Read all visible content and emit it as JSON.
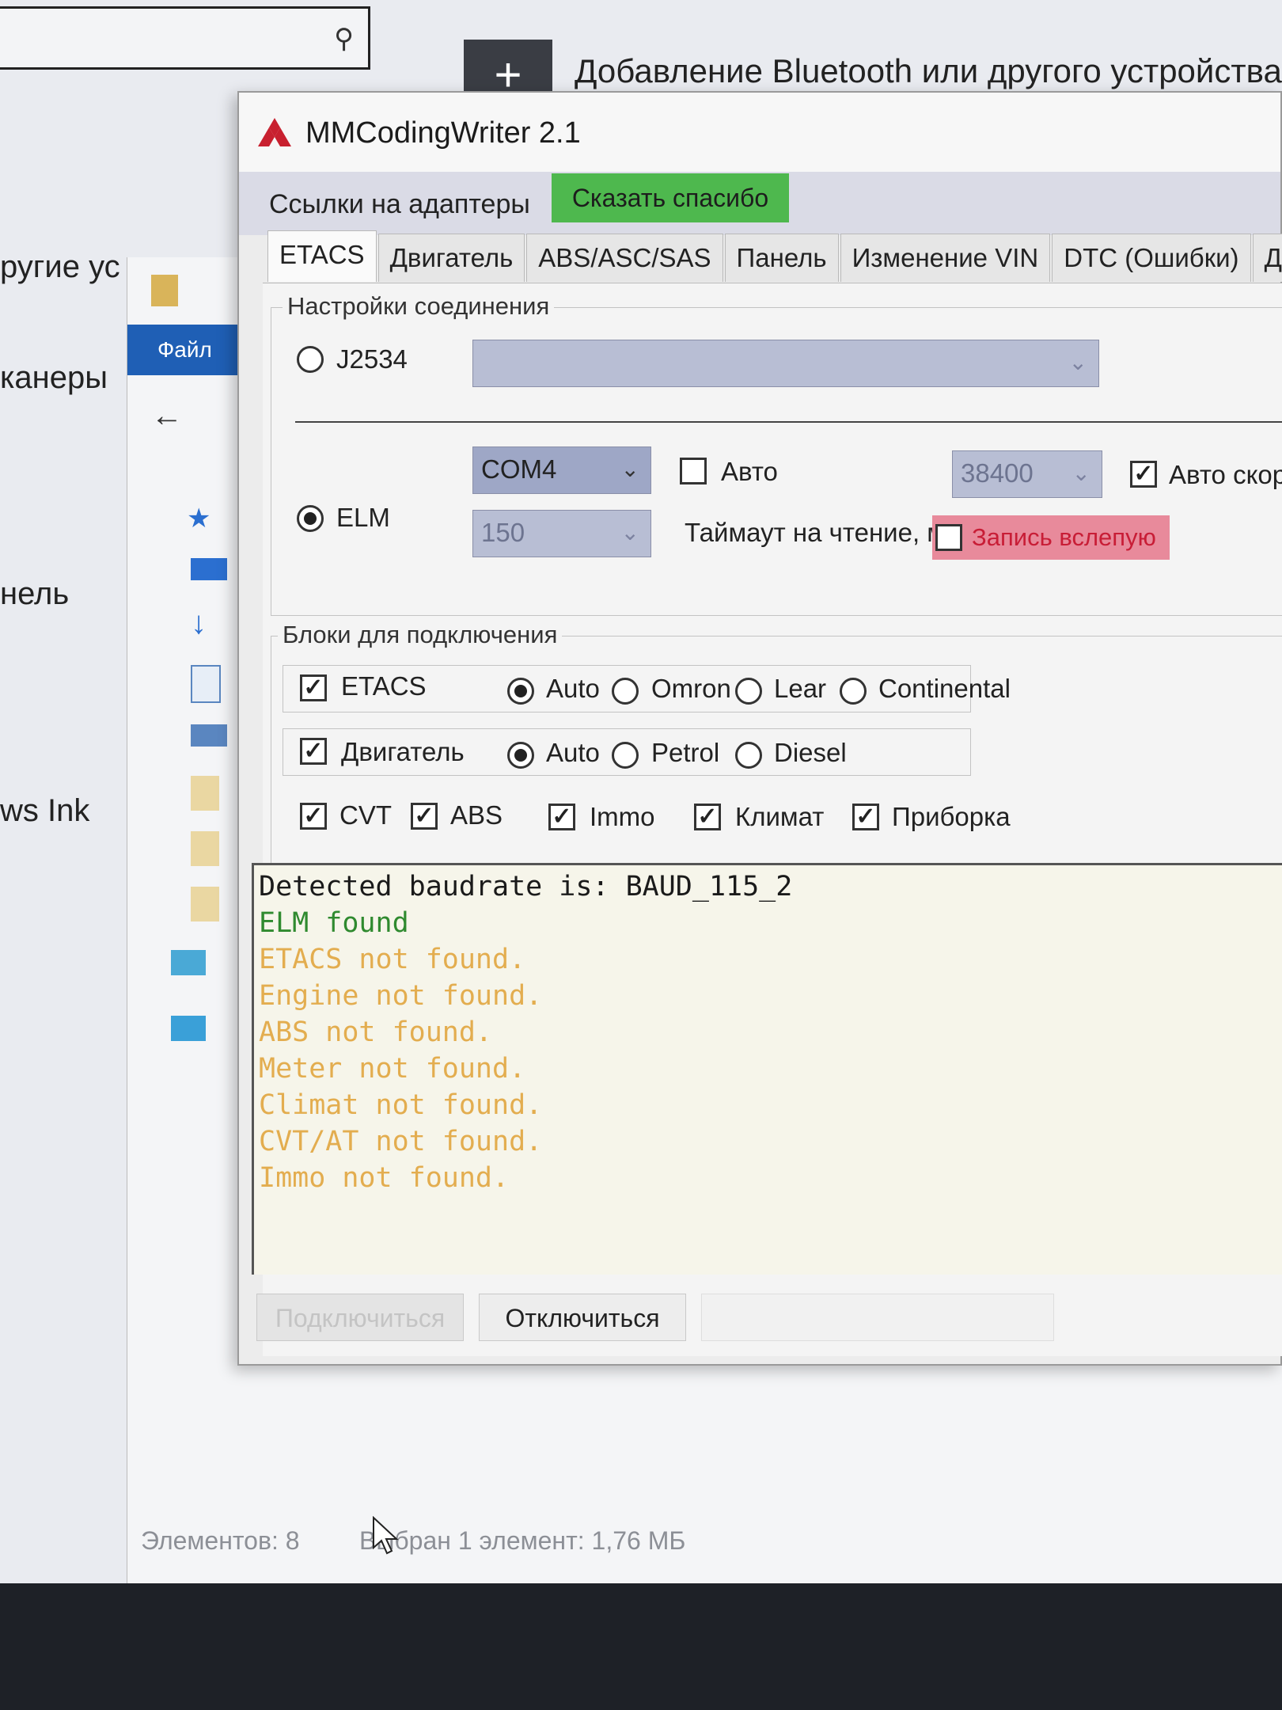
{
  "background": {
    "add_device_text": "Добавление Bluetooth или другого устройства",
    "side_texts": [
      "ругие ус",
      "канеры",
      "нель",
      "ws Ink"
    ]
  },
  "explorer": {
    "ribbon_tab": "Файл",
    "status_items": "Элементов: 8",
    "status_selected": "Выбран 1 элемент: 1,76 МБ"
  },
  "app": {
    "title": "MMCodingWriter 2.1",
    "menu_links": "Ссылки на адаптеры",
    "thanks_button": "Сказать спасибо",
    "tabs": [
      "ETACS",
      "Двигатель",
      "ABS/ASC/SAS",
      "Панель",
      "Изменение VIN",
      "DTC (Ошибки)",
      "Други"
    ],
    "active_tab": 0,
    "connection": {
      "legend": "Настройки соединения",
      "j2534_label": "J2534",
      "j2534_selected": false,
      "elm_label": "ELM",
      "elm_selected": true,
      "port_value": "COM4",
      "auto_label": "Авто",
      "auto_checked": false,
      "baud_value": "38400",
      "auto_speed_label": "Авто скорост",
      "auto_speed_checked": true,
      "timeout_value": "150",
      "timeout_label": "Таймаут на чтение, мс",
      "blind_label": "Запись вслепую",
      "blind_checked": false
    },
    "blocks": {
      "legend": "Блоки для подключения",
      "etacs_label": "ETACS",
      "etacs_options": [
        "Auto",
        "Omron",
        "Lear",
        "Continental"
      ],
      "engine_label": "Двигатель",
      "engine_options": [
        "Auto",
        "Petrol",
        "Diesel"
      ],
      "extras": [
        "CVT",
        "ABS",
        "Immo",
        "Климат",
        "Приборка"
      ]
    },
    "log": [
      {
        "text": "Detected baudrate is: BAUD_115_2",
        "color": "#1a1a1a"
      },
      {
        "text": "ELM found",
        "color": "#2f8a2f"
      },
      {
        "text": "ETACS not found.",
        "color": "#e3ad4f"
      },
      {
        "text": "Engine not found.",
        "color": "#e3ad4f"
      },
      {
        "text": "ABS not found.",
        "color": "#e3ad4f"
      },
      {
        "text": "Meter not found.",
        "color": "#e3ad4f"
      },
      {
        "text": "Climat not found.",
        "color": "#e3ad4f"
      },
      {
        "text": "CVT/AT not found.",
        "color": "#e3ad4f"
      },
      {
        "text": "Immo not found.",
        "color": "#e3ad4f"
      }
    ],
    "buttons": {
      "connect": "Подключиться",
      "disconnect": "Отключиться"
    }
  },
  "colors": {
    "accent_green": "#4eb84e",
    "blind_pink": "#e88a9b",
    "combo_blue": "#9ea7c6",
    "explorer_ribbon": "#1f5fb5"
  }
}
